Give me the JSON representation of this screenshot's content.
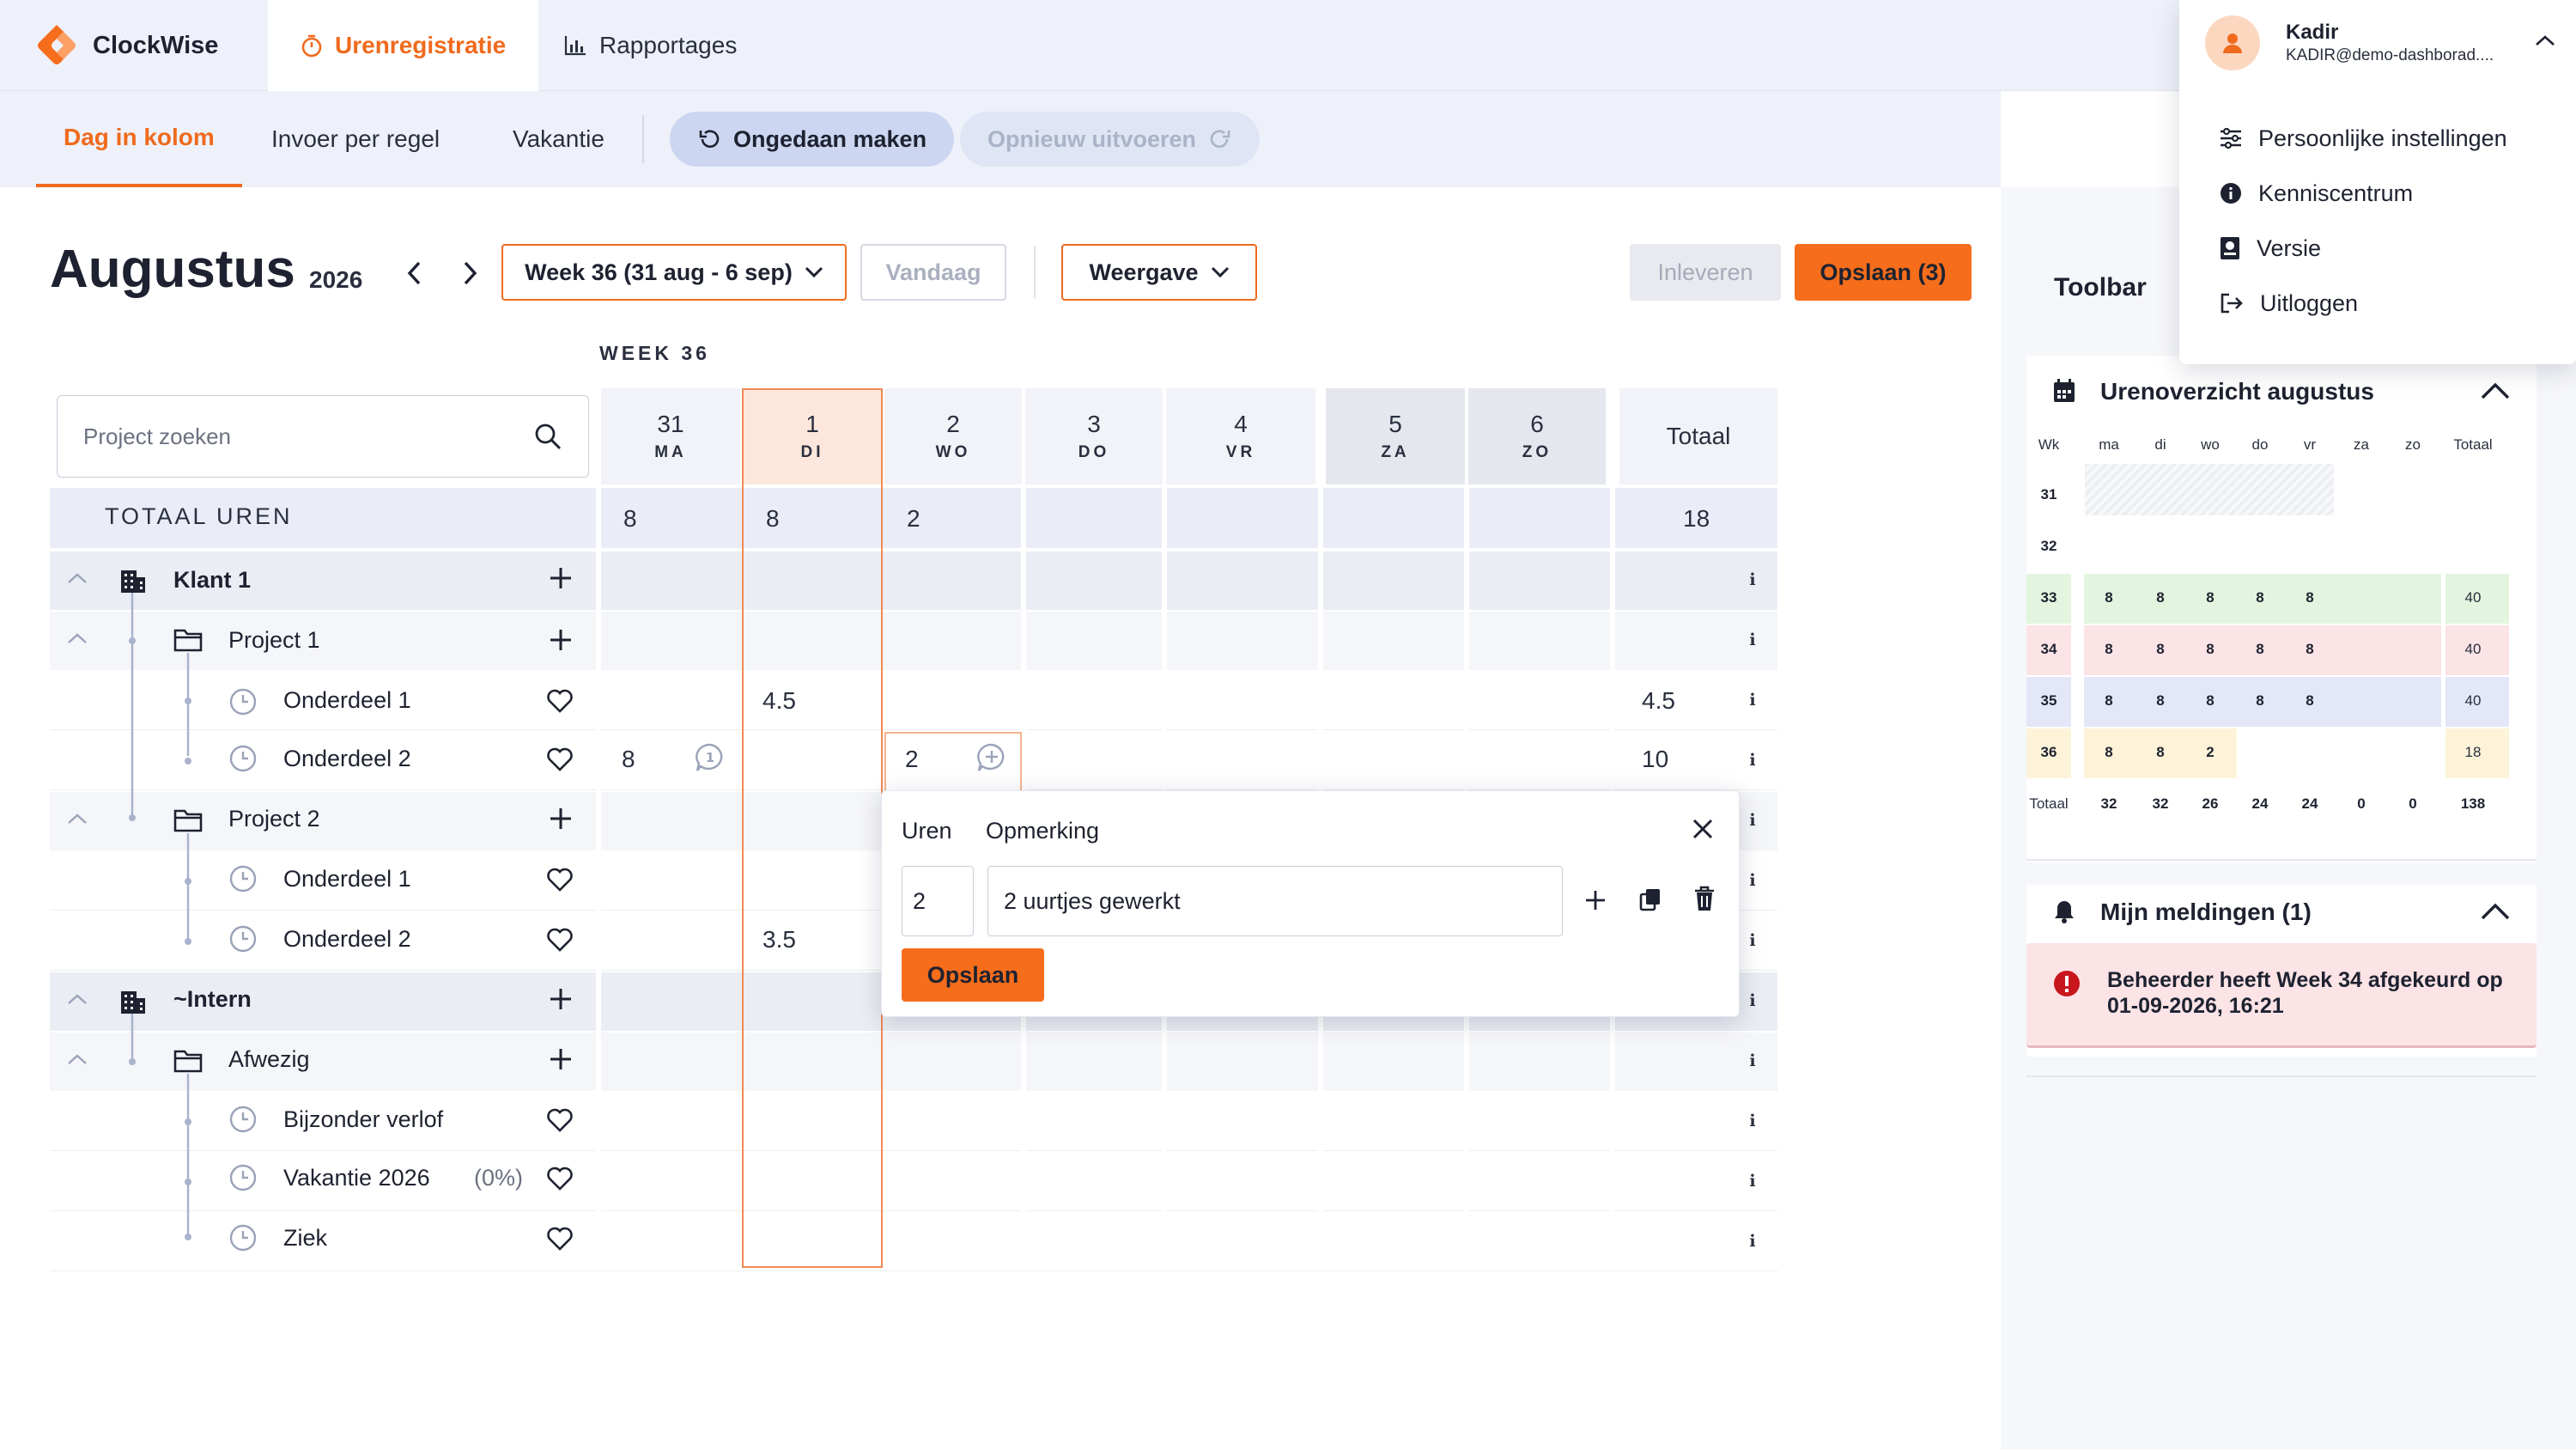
{
  "app": {
    "name": "ClockWise"
  },
  "nav": {
    "tabs": [
      {
        "label": "Urenregistratie",
        "active": true
      },
      {
        "label": "Rapportages"
      }
    ]
  },
  "subnav": {
    "tabs": [
      "Dag in kolom",
      "Invoer per regel",
      "Vakantie"
    ],
    "undo": "Ongedaan maken",
    "redo": "Opnieuw uitvoeren"
  },
  "header": {
    "month": "Augustus",
    "year": "2026",
    "week_select": "Week 36 (31 aug - 6 sep)",
    "today": "Vandaag",
    "view": "Weergave",
    "submit": "Inleveren",
    "save": "Opslaan (3)"
  },
  "grid": {
    "week_label": "WEEK 36",
    "search_placeholder": "Project zoeken",
    "days": [
      {
        "num": "31",
        "name": "MA"
      },
      {
        "num": "1",
        "name": "DI"
      },
      {
        "num": "2",
        "name": "WO"
      },
      {
        "num": "3",
        "name": "DO"
      },
      {
        "num": "4",
        "name": "VR"
      },
      {
        "num": "5",
        "name": "ZA"
      },
      {
        "num": "6",
        "name": "ZO"
      }
    ],
    "total_col": "Totaal",
    "totals": {
      "label": "TOTAAL UREN",
      "values": [
        "8",
        "8",
        "2",
        "",
        "",
        "",
        ""
      ],
      "total": "18"
    },
    "rows": [
      {
        "label": "Klant 1"
      },
      {
        "label": "Project 1"
      },
      {
        "label": "Onderdeel 1",
        "di": "4.5",
        "total": "4.5"
      },
      {
        "label": "Onderdeel 2",
        "ma": "8",
        "wo": "2",
        "total": "10"
      },
      {
        "label": "Project 2"
      },
      {
        "label": "Onderdeel 1"
      },
      {
        "label": "Onderdeel 2",
        "di": "3.5"
      },
      {
        "label": "~Intern"
      },
      {
        "label": "Afwezig"
      },
      {
        "label": "Bijzonder verlof"
      },
      {
        "label": "Vakantie 2026",
        "pct": "(0%)"
      },
      {
        "label": "Ziek"
      }
    ],
    "info": "i"
  },
  "popover": {
    "hours_label": "Uren",
    "remark_label": "Opmerking",
    "hours_value": "2",
    "remark_value": "2 uurtjes gewerkt",
    "save": "Opslaan"
  },
  "toolbar": {
    "title": "Toolbar",
    "overview": {
      "title": "Urenoverzicht augustus",
      "headers": [
        "Wk",
        "ma",
        "di",
        "wo",
        "do",
        "vr",
        "za",
        "zo",
        "Totaal"
      ],
      "rows": [
        {
          "wk": "31",
          "vals": [
            "",
            "",
            "",
            "",
            "",
            "",
            ""
          ],
          "total": ""
        },
        {
          "wk": "32",
          "vals": [
            "",
            "",
            "",
            "",
            "",
            "",
            ""
          ],
          "total": ""
        },
        {
          "wk": "33",
          "vals": [
            "8",
            "8",
            "8",
            "8",
            "8",
            "",
            ""
          ],
          "total": "40"
        },
        {
          "wk": "34",
          "vals": [
            "8",
            "8",
            "8",
            "8",
            "8",
            "",
            ""
          ],
          "total": "40"
        },
        {
          "wk": "35",
          "vals": [
            "8",
            "8",
            "8",
            "8",
            "8",
            "",
            ""
          ],
          "total": "40"
        },
        {
          "wk": "36",
          "vals": [
            "8",
            "8",
            "2",
            "",
            "",
            "",
            ""
          ],
          "total": "18"
        }
      ],
      "total_row": {
        "label": "Totaal",
        "vals": [
          "32",
          "32",
          "26",
          "24",
          "24",
          "0",
          "0"
        ],
        "total": "138"
      }
    },
    "notifications": {
      "title": "Mijn meldingen (1)",
      "message": "Beheerder heeft Week 34 afgekeurd op 01-09-2026, 16:21"
    }
  },
  "user": {
    "name": "Kadir",
    "email": "KADIR@demo-dashborad....",
    "menu": [
      "Persoonlijke instellingen",
      "Kenniscentrum",
      "Versie",
      "Uitloggen"
    ]
  },
  "colors": {
    "accent": "#f66d1b",
    "week33": "#e3f5df",
    "week34": "#fbe3e6",
    "week35": "#e3e7f7",
    "week36": "#fcf3d9",
    "alert": "#c8161d"
  }
}
